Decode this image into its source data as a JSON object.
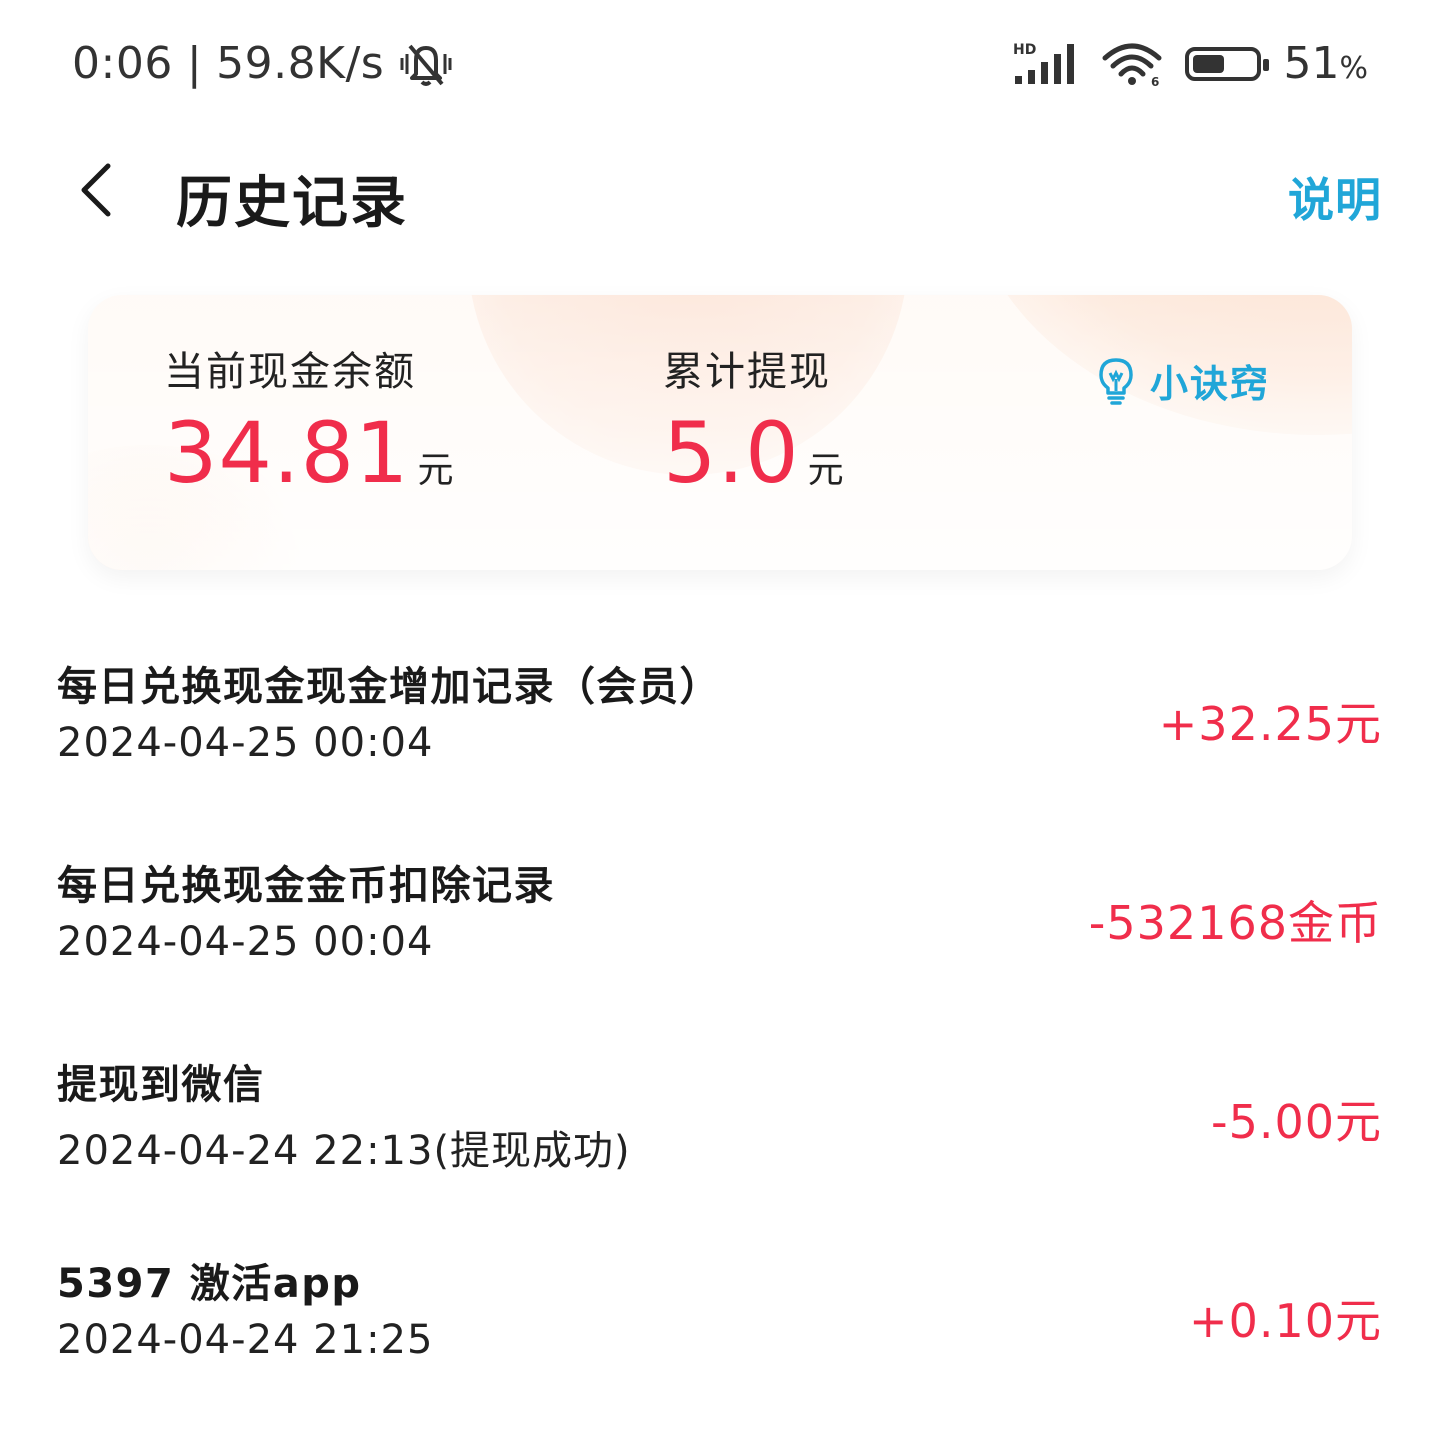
{
  "status_bar": {
    "time": "0:06",
    "net_speed": "59.8K/s",
    "network_type": "HD",
    "battery_level": 51,
    "battery_text": "51",
    "battery_unit": "%",
    "icons": [
      "mute-bell-icon",
      "signal-icon",
      "wifi-icon",
      "battery-icon"
    ]
  },
  "header": {
    "title": "历史记录",
    "help_label": "说明"
  },
  "summary": {
    "balance_label": "当前现金余额",
    "balance_value": "34.81",
    "balance_unit": "元",
    "withdraw_label": "累计提现",
    "withdraw_value": "5.0",
    "withdraw_unit": "元",
    "tips_label": "小诀窍",
    "accent_color": "#f02d4b",
    "link_color": "#20a6d8"
  },
  "records": [
    {
      "title": "每日兑换现金现金增加记录（会员）",
      "time": "2024-04-25 00:04",
      "amount": "+32.25元"
    },
    {
      "title": "每日兑换现金金币扣除记录",
      "time": "2024-04-25 00:04",
      "amount": "-532168金币"
    },
    {
      "title": "提现到微信",
      "time": "2024-04-24 22:13(提现成功)",
      "amount": "-5.00元"
    },
    {
      "title": "5397 激活app",
      "time": "2024-04-24 21:25",
      "amount": "+0.10元"
    }
  ]
}
